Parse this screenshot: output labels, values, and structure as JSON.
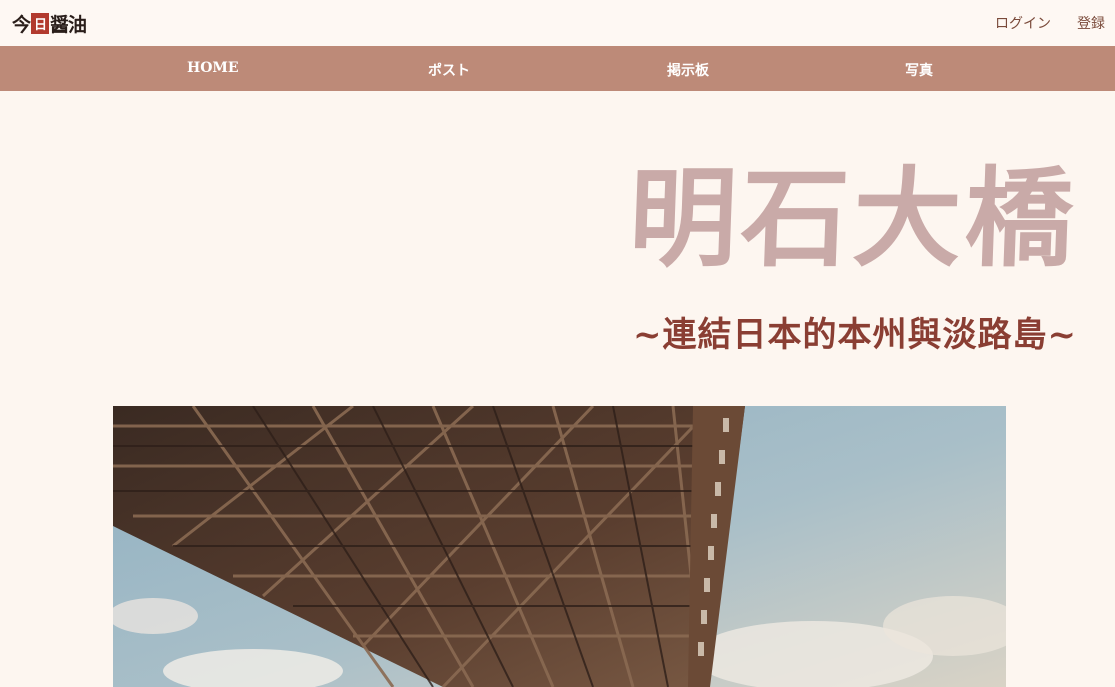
{
  "header": {
    "logo_text_left": "今",
    "logo_text_mid": "日",
    "logo_text_right": "醤油",
    "login_label": "ログイン",
    "register_label": "登録"
  },
  "nav": {
    "home": "HOME",
    "posts": "ポスト",
    "board": "掲示板",
    "photos": "写真"
  },
  "hero": {
    "title": "明石大橋",
    "subtitle": "~連結日本的本州與淡路島~"
  },
  "colors": {
    "background": "#fdf6f0",
    "nav_bar": "#bd8a78",
    "title": "#c9aaa8",
    "subtitle": "#8a3e33",
    "top_link": "#7a4a3a"
  }
}
